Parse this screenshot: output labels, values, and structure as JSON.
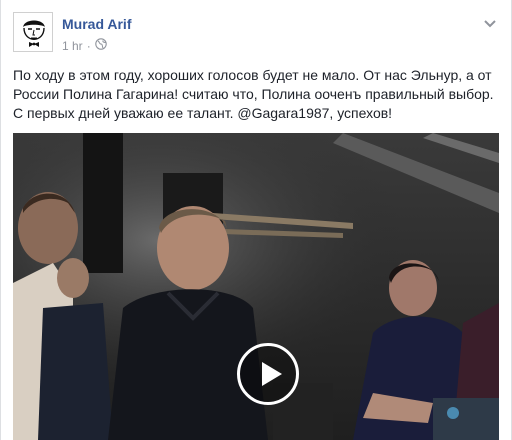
{
  "post": {
    "author": "Murad Arif",
    "time": "1 hr",
    "text": "По ходу в этом году, хороших голосов будет не мало. От нас Эльнур, а от России Полина Гагарина! считаю что, Полина ооченъ правильный выбор. С первых дней уважаю ее талант. @Gagara1987, успехов!"
  },
  "icons": {
    "privacy": "globe-icon",
    "options": "chevron-down-icon",
    "play": "play-icon"
  },
  "colors": {
    "author_link": "#365899",
    "meta_text": "#90949c",
    "body_text": "#1d2129"
  }
}
